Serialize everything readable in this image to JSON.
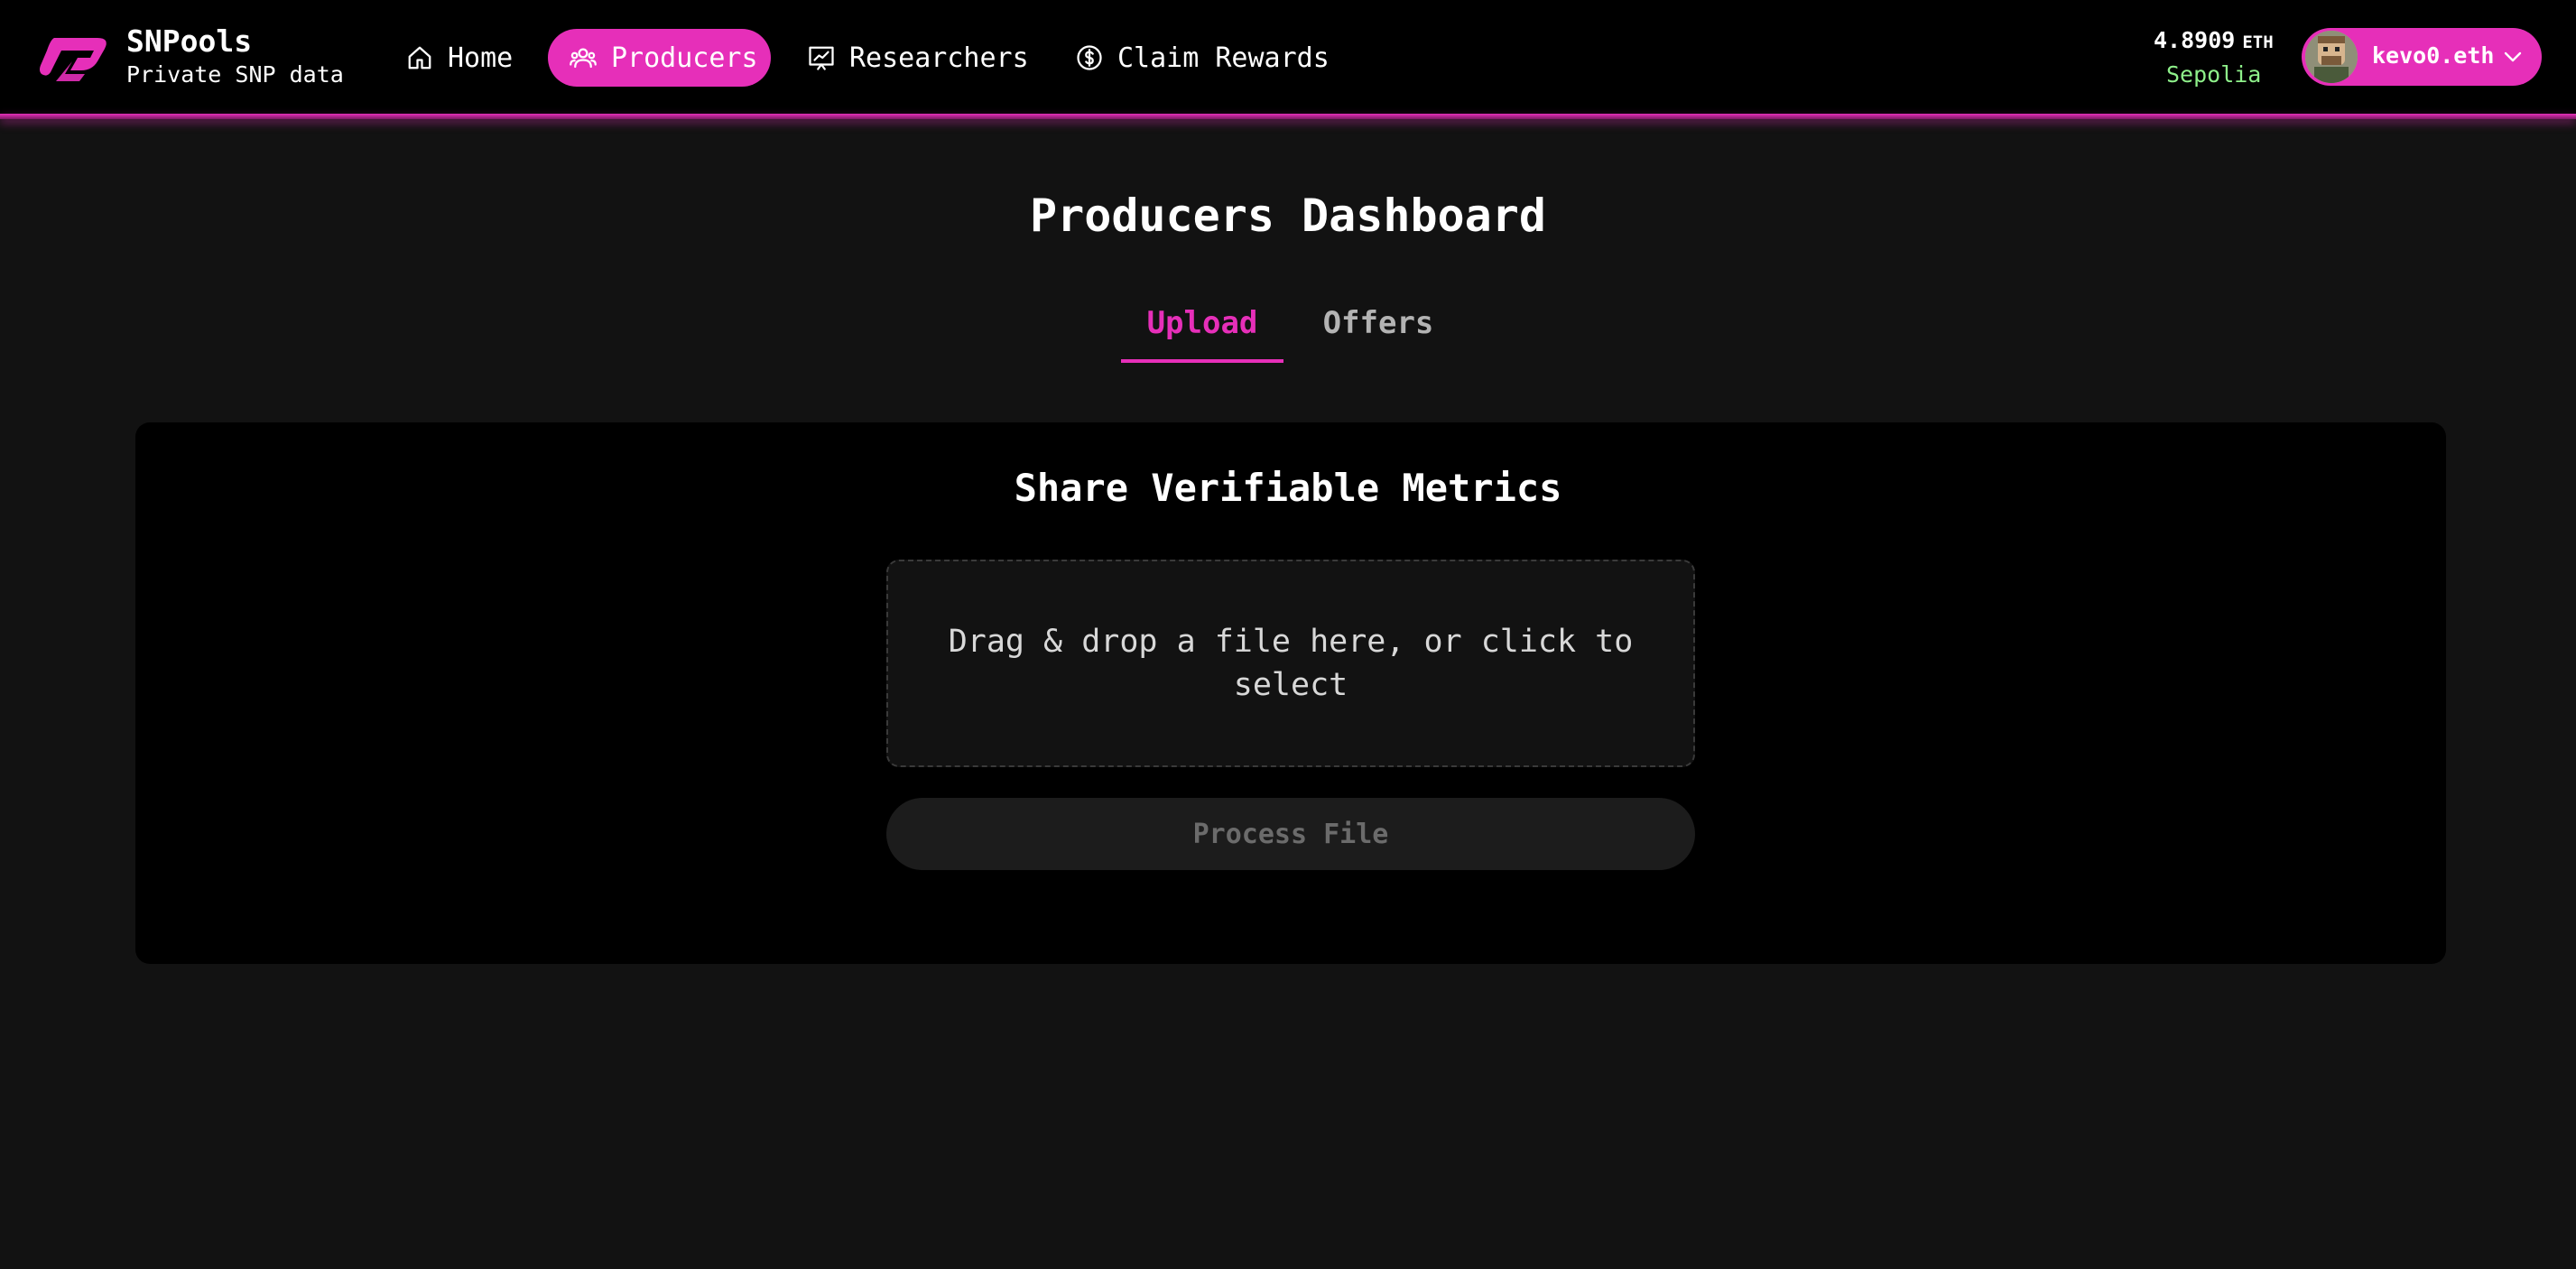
{
  "brand": {
    "name": "SNPools",
    "subtitle": "Private SNP data"
  },
  "nav": {
    "home": "Home",
    "producers": "Producers",
    "researchers": "Researchers",
    "claim": "Claim Rewards",
    "active": "Producers"
  },
  "wallet": {
    "balance": "4.8909",
    "unit": "ETH",
    "network": "Sepolia",
    "account": "kevo0.eth"
  },
  "main": {
    "title": "Producers Dashboard",
    "tabs": {
      "upload": "Upload",
      "offers": "Offers",
      "active": "Upload"
    },
    "panel_title": "Share Verifiable Metrics",
    "dropzone_text": "Drag & drop a file here, or click to select",
    "process_button": "Process File"
  },
  "colors": {
    "accent": "#e62fb9",
    "background": "#121212",
    "header": "#000000",
    "network_green": "#8ef08a"
  },
  "icons": [
    "logo-icon",
    "home-icon",
    "users-icon",
    "chart-icon",
    "dollar-icon",
    "chevron-down-icon"
  ]
}
